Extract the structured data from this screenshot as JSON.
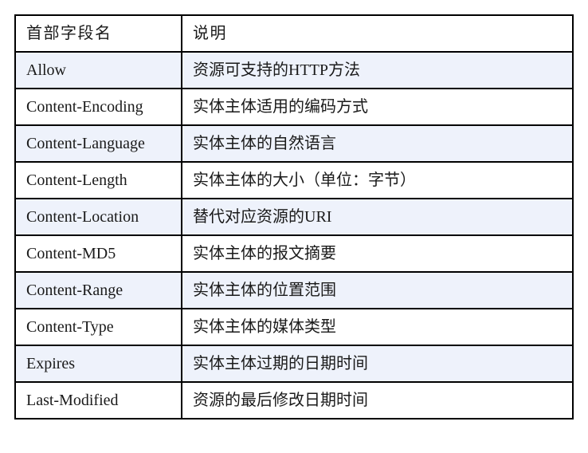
{
  "table": {
    "columns": [
      "首部字段名",
      "说明"
    ],
    "rows": [
      {
        "field": "Allow",
        "description": "资源可支持的HTTP方法"
      },
      {
        "field": "Content-Encoding",
        "description": "实体主体适用的编码方式"
      },
      {
        "field": "Content-Language",
        "description": "实体主体的自然语言"
      },
      {
        "field": "Content-Length",
        "description": "实体主体的大小（单位：字节）"
      },
      {
        "field": "Content-Location",
        "description": "替代对应资源的URI"
      },
      {
        "field": "Content-MD5",
        "description": "实体主体的报文摘要"
      },
      {
        "field": "Content-Range",
        "description": "实体主体的位置范围"
      },
      {
        "field": "Content-Type",
        "description": "实体主体的媒体类型"
      },
      {
        "field": "Expires",
        "description": "实体主体过期的日期时间"
      },
      {
        "field": "Last-Modified",
        "description": "资源的最后修改日期时间"
      }
    ]
  },
  "style": {
    "border_color": "#000000",
    "tint_color": "#eef2fb",
    "background_color": "#ffffff",
    "text_color": "#1a1a1a"
  }
}
